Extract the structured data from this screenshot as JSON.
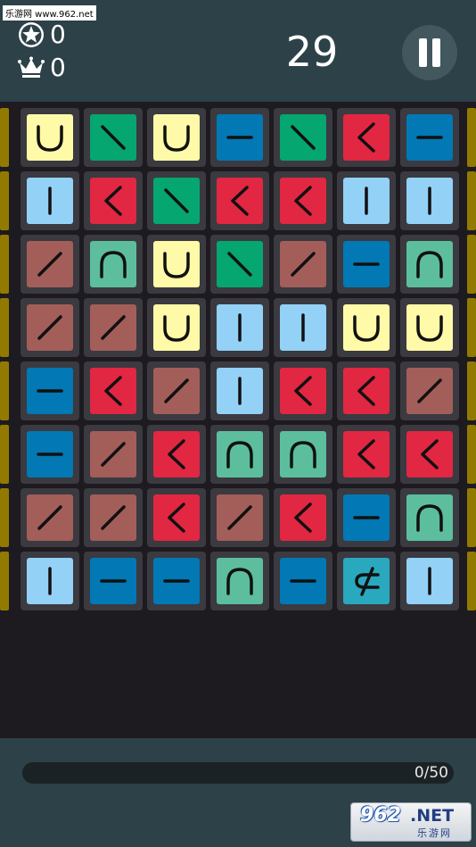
{
  "header": {
    "watermark": "乐游网 www.962.net",
    "stars": "0",
    "crowns": "0",
    "timer": "29"
  },
  "progress": {
    "label": "0/50",
    "fraction": 0.0
  },
  "logo": {
    "brand": "962",
    "suffix": ".NET",
    "subtitle": "乐游网"
  },
  "board": {
    "columns": 7,
    "rows": [
      [
        "u-curve",
        "back-slash",
        "u-curve",
        "dash",
        "back-slash",
        "chevron-left",
        "dash"
      ],
      [
        "bar",
        "chevron-left",
        "back-slash",
        "chevron-left",
        "chevron-left",
        "bar",
        "bar"
      ],
      [
        "slash",
        "arch",
        "u-curve",
        "back-slash",
        "slash",
        "dash",
        "arch"
      ],
      [
        "slash",
        "slash",
        "u-curve",
        "bar",
        "bar",
        "u-curve",
        "u-curve"
      ],
      [
        "dash",
        "chevron-left",
        "slash",
        "bar",
        "chevron-left",
        "chevron-left",
        "slash"
      ],
      [
        "dash",
        "slash",
        "chevron-left",
        "arch",
        "arch",
        "chevron-left",
        "chevron-left"
      ],
      [
        "slash",
        "slash",
        "chevron-left",
        "slash",
        "chevron-left",
        "dash",
        "arch"
      ],
      [
        "bar",
        "dash",
        "dash",
        "arch",
        "dash",
        "not-subset",
        "bar"
      ]
    ],
    "tile_colors": {
      "u-curve": "#fffaa8",
      "back-slash": "#05a66f",
      "dash": "#0278b4",
      "chevron-left": "#e12742",
      "bar": "#93d1f6",
      "slash": "#a35e59",
      "arch": "#5cbe9d",
      "not-subset": "#29a8be"
    },
    "border_color": "#927a00"
  }
}
